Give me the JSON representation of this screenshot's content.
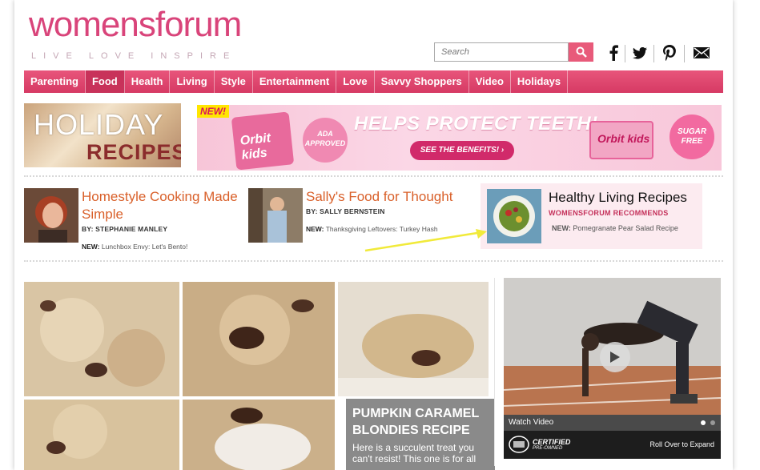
{
  "logo": {
    "wordmark": "womensforum",
    "tagline": "LIVE LOVE INSPIRE"
  },
  "search": {
    "placeholder": "Search"
  },
  "social": [
    "facebook-icon",
    "twitter-icon",
    "pinterest-icon",
    "email-icon"
  ],
  "nav": {
    "items": [
      "Parenting",
      "Food",
      "Health",
      "Living",
      "Style",
      "Entertainment",
      "Love",
      "Savvy Shoppers",
      "Video",
      "Holidays"
    ],
    "active": "Food"
  },
  "holiday_banner": {
    "line1": "HOLIDAY",
    "line2": "RECIPES"
  },
  "ad": {
    "badge": "NEW!",
    "brand1": "Orbit kids",
    "seal": "ADA APPROVED",
    "headline": "HELPS PROTECT TEETH!",
    "cta": "SEE THE BENEFITS!",
    "brand2": "Orbit kids",
    "seal2": "SUGAR FREE"
  },
  "columns": [
    {
      "title": "Homestyle Cooking Made Simple",
      "byline": "BY: STEPHANIE MANLEY",
      "new_label": "NEW:",
      "new_text": "Lunchbox Envy: Let's Bento!"
    },
    {
      "title": "Sally's Food for Thought",
      "byline": "BY: SALLY BERNSTEIN",
      "new_label": "NEW:",
      "new_text": "Thanksgiving Leftovers: Turkey Hash"
    },
    {
      "title": "Healthy Living Recipes",
      "byline": "WOMENSFORUM RECOMMENDS",
      "new_label": "NEW:",
      "new_text": "Pomegranate Pear Salad Recipe"
    }
  ],
  "feature": {
    "title": "PUMPKIN CARAMEL BLONDIES RECIPE",
    "description": "Here is a succulent treat you can't resist! This one is for all"
  },
  "video": {
    "label": "Watch Video",
    "certified": "CERTIFIED",
    "preowned": "PRE-OWNED",
    "hint": "Roll Over to Expand"
  },
  "colors": {
    "brand": "#d9447a",
    "nav": "#e04a70",
    "accent_orange": "#d9602a"
  }
}
